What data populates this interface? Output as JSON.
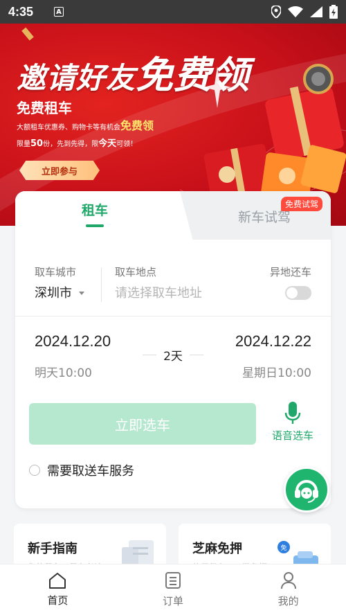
{
  "status_bar": {
    "time": "4:35",
    "notification_icon_letter": "A"
  },
  "banner": {
    "title_part1": "邀请好友",
    "title_part2": "免费领",
    "subtitle": "免费租车",
    "line2_prefix": "大额租车优惠券、购物卡等有机会",
    "line2_highlight": "免费领",
    "line3_a": "限量",
    "line3_b": "50",
    "line3_c": "份，先到先得，限",
    "line3_d": "今天",
    "line3_e": "可领！",
    "cta": "立即参与"
  },
  "booking": {
    "tab_rent": "租车",
    "tab_new_car": "新车试驾",
    "tab_new_car_badge": "免费试驾",
    "city_label": "取车城市",
    "city_value": "深圳市",
    "address_label": "取车地点",
    "address_placeholder": "请选择取车地址",
    "return_other_label": "异地还车",
    "return_other_enabled": false,
    "start_date": "2024.12.20",
    "start_time": "明天10:00",
    "duration": "2天",
    "end_date": "2024.12.22",
    "end_time": "星期日10:00",
    "select_button": "立即选车",
    "voice_select": "语音选车",
    "pickup_service_label": "需要取送车服务",
    "pickup_service_checked": false
  },
  "cards": {
    "guide_title": "新手指南",
    "guide_sub": "你的租车，租车必读",
    "zhima_title": "芝麻免押",
    "zhima_sub": "信用借车，一键免押"
  },
  "bottom_nav": [
    {
      "label": "首页",
      "icon": "home-icon",
      "active": true
    },
    {
      "label": "订单",
      "icon": "order-icon",
      "active": false
    },
    {
      "label": "我的",
      "icon": "profile-icon",
      "active": false
    }
  ],
  "colors": {
    "brand_green": "#1fa86a",
    "banner_red": "#c8101a",
    "disabled_green": "#b5e8cf"
  }
}
